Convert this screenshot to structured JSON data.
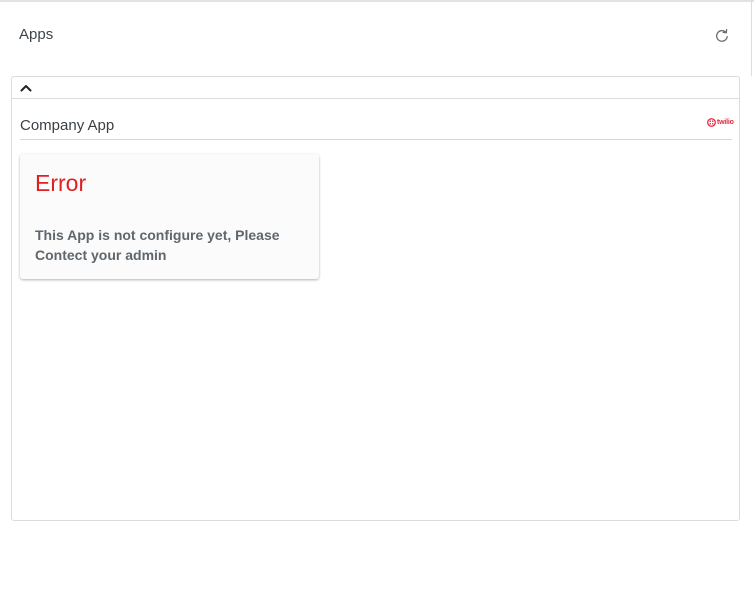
{
  "header": {
    "title": "Apps",
    "refresh_icon": "refresh-icon"
  },
  "panel": {
    "collapse_icon": "chevron-up-icon",
    "app": {
      "title": "Company App",
      "logo_icon": "twilio-logo",
      "logo_text": "twilio",
      "logo_color": "#e3273f"
    },
    "error": {
      "title": "Error",
      "message": "This App is not configure yet, Please Contect your admin",
      "title_color": "#e02020"
    }
  }
}
